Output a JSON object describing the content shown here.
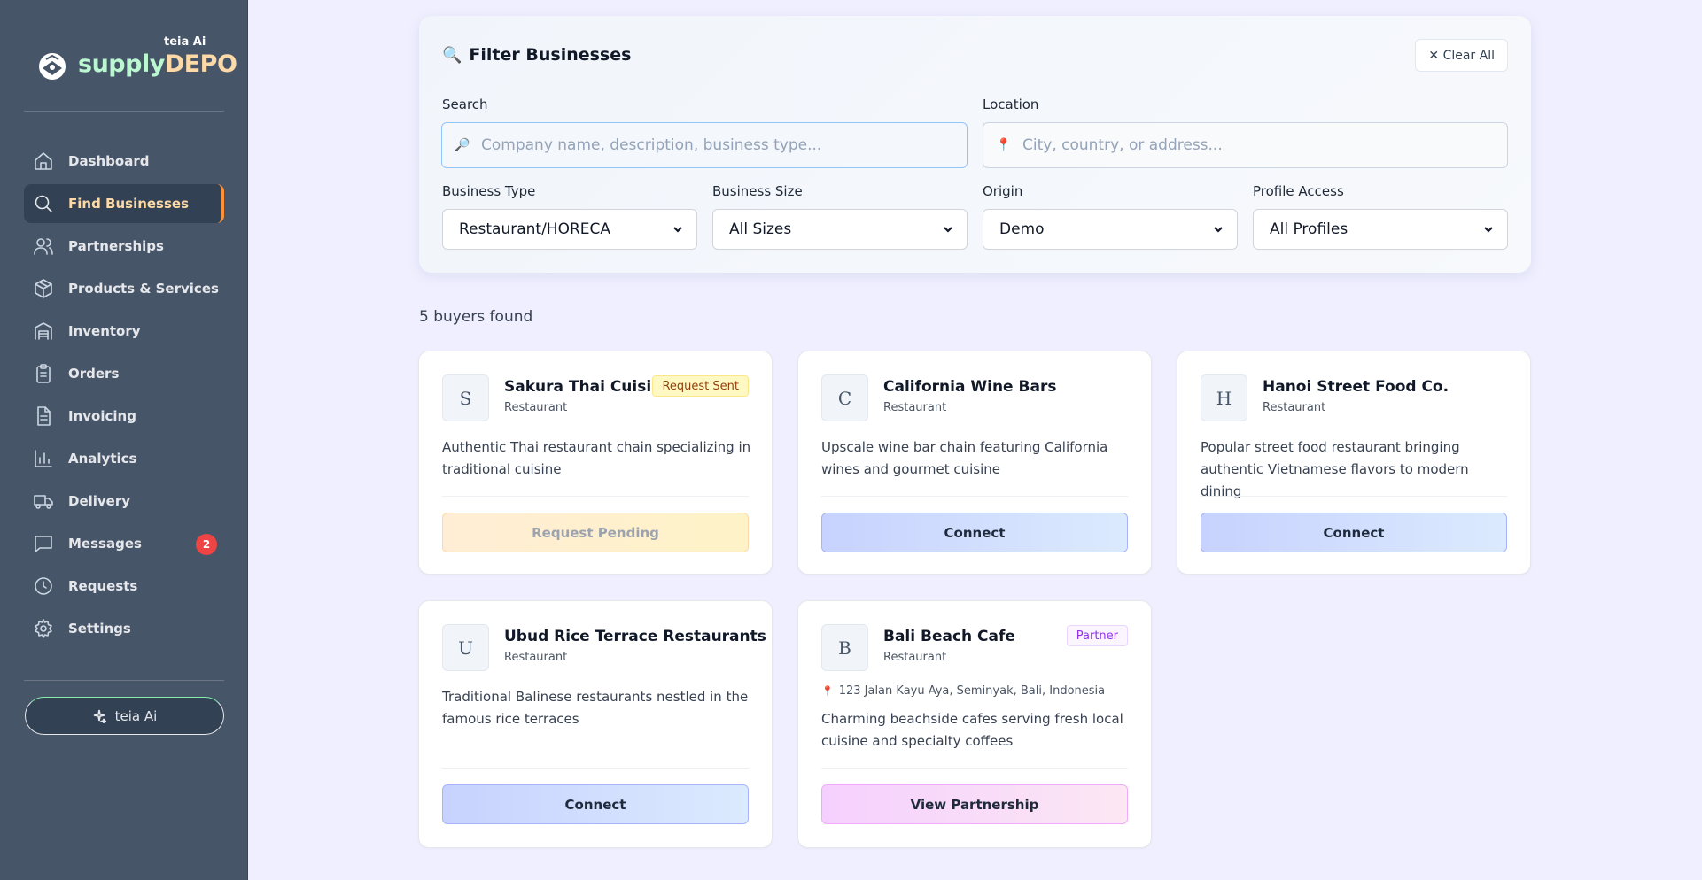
{
  "brand": {
    "small": "teia Ai",
    "name_part1": "supply",
    "name_part2": "DEPO"
  },
  "nav": [
    {
      "label": "Dashboard",
      "icon": "home-icon",
      "active": false
    },
    {
      "label": "Find Businesses",
      "icon": "search-icon",
      "active": true
    },
    {
      "label": "Partnerships",
      "icon": "users-icon",
      "active": false
    },
    {
      "label": "Products & Services",
      "icon": "package-icon",
      "active": false
    },
    {
      "label": "Inventory",
      "icon": "warehouse-icon",
      "active": false
    },
    {
      "label": "Orders",
      "icon": "clipboard-icon",
      "active": false
    },
    {
      "label": "Invoicing",
      "icon": "file-text-icon",
      "active": false
    },
    {
      "label": "Analytics",
      "icon": "bar-chart-icon",
      "active": false
    },
    {
      "label": "Delivery",
      "icon": "truck-icon",
      "active": false
    },
    {
      "label": "Messages",
      "icon": "message-icon",
      "active": false,
      "badge": "2"
    },
    {
      "label": "Requests",
      "icon": "clock-icon",
      "active": false
    },
    {
      "label": "Settings",
      "icon": "gear-icon",
      "active": false
    }
  ],
  "teia_button": {
    "label": "teia Ai",
    "icon": "sparkle-icon"
  },
  "filter": {
    "title": "Filter Businesses",
    "clear_label": "✕ Clear All",
    "search_label": "Search",
    "search_placeholder": "Company name, description, business type...",
    "location_label": "Location",
    "location_placeholder": "City, country, or address...",
    "business_type_label": "Business Type",
    "business_type_value": "Restaurant/HORECA",
    "business_size_label": "Business Size",
    "business_size_value": "All Sizes",
    "origin_label": "Origin",
    "origin_value": "Demo",
    "profile_access_label": "Profile Access",
    "profile_access_value": "All Profiles"
  },
  "results_count": "5 buyers found",
  "cards": [
    {
      "initial": "S",
      "name": "Sakura Thai Cuisine",
      "type": "Restaurant",
      "tag": "Request Sent",
      "description": "Authentic Thai restaurant chain specializing in traditional cuisine",
      "button": "Request Pending"
    },
    {
      "initial": "C",
      "name": "California Wine Bars",
      "type": "Restaurant",
      "description": "Upscale wine bar chain featuring California wines and gourmet cuisine",
      "button": "Connect"
    },
    {
      "initial": "H",
      "name": "Hanoi Street Food Co.",
      "type": "Restaurant",
      "description": "Popular street food restaurant bringing authentic Vietnamese flavors to modern dining",
      "button": "Connect"
    },
    {
      "initial": "U",
      "name": "Ubud Rice Terrace Restaurants",
      "type": "Restaurant",
      "description": "Traditional Balinese restaurants nestled in the famous rice terraces",
      "button": "Connect"
    },
    {
      "initial": "B",
      "name": "Bali Beach Cafe",
      "type": "Restaurant",
      "tag": "Partner",
      "address": "123 Jalan Kayu Aya, Seminyak, Bali, Indonesia",
      "description": "Charming beachside cafes serving fresh local cuisine and specialty coffees",
      "button": "View Partnership"
    }
  ],
  "colors": {
    "sidebar": "#475569",
    "active_nav": "#334155",
    "active_accent": "#fb923c",
    "background": "#efefff",
    "badge": "#ef4444"
  }
}
